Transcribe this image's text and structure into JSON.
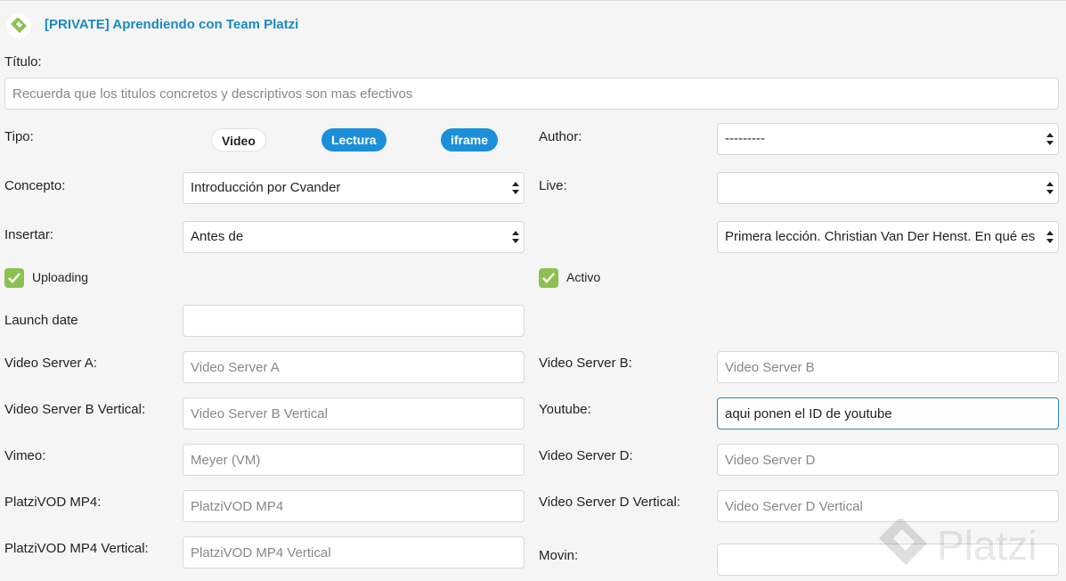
{
  "header": {
    "title": "[PRIVATE] Aprendiendo con Team Platzi",
    "logo_icon": "platzi-logo-icon"
  },
  "titulo": {
    "label": "Título:",
    "placeholder": "Recuerda que los titulos concretos y descriptivos son mas efectivos",
    "value": ""
  },
  "tipo": {
    "label": "Tipo:",
    "options": [
      "Video",
      "Lectura",
      "iframe"
    ]
  },
  "author": {
    "label": "Author:",
    "value": "---------"
  },
  "concepto": {
    "label": "Concepto:",
    "value": "Introducción por Cvander"
  },
  "live": {
    "label": "Live:",
    "value": ""
  },
  "insertar": {
    "label": "Insertar:",
    "position_value": "Antes de",
    "lesson_value": "Primera lección. Christian Van Der Henst. En qué es"
  },
  "uploading": {
    "label": "Uploading",
    "checked": true
  },
  "activo": {
    "label": "Activo",
    "checked": true
  },
  "launch_date": {
    "label": "Launch date",
    "value": ""
  },
  "video_server_a": {
    "label": "Video Server A:",
    "placeholder": "Video Server A"
  },
  "video_server_b": {
    "label": "Video Server B:",
    "placeholder": "Video Server B"
  },
  "video_server_b_vertical": {
    "label": "Video Server B Vertical:",
    "placeholder": "Video Server B Vertical"
  },
  "youtube": {
    "label": "Youtube:",
    "value": "aqui ponen el ID de youtube"
  },
  "vimeo": {
    "label": "Vimeo:",
    "placeholder": "Meyer (VM)"
  },
  "video_server_d": {
    "label": "Video Server D:",
    "placeholder": "Video Server D"
  },
  "platzivod_mp4": {
    "label": "PlatziVOD MP4:",
    "placeholder": "PlatziVOD MP4"
  },
  "video_server_d_vertical": {
    "label": "Video Server D Vertical:",
    "placeholder": "Video Server D Vertical"
  },
  "platzivod_mp4_vertical": {
    "label": "PlatziVOD MP4 Vertical:",
    "placeholder": "PlatziVOD MP4 Vertical"
  },
  "movin": {
    "label": "Movin:",
    "value": ""
  },
  "watermark": {
    "text": "Platzi"
  },
  "colors": {
    "accent": "#1b8fd9",
    "title": "#1a8ac0",
    "check": "#8cc152",
    "focus": "#2b84c4"
  }
}
